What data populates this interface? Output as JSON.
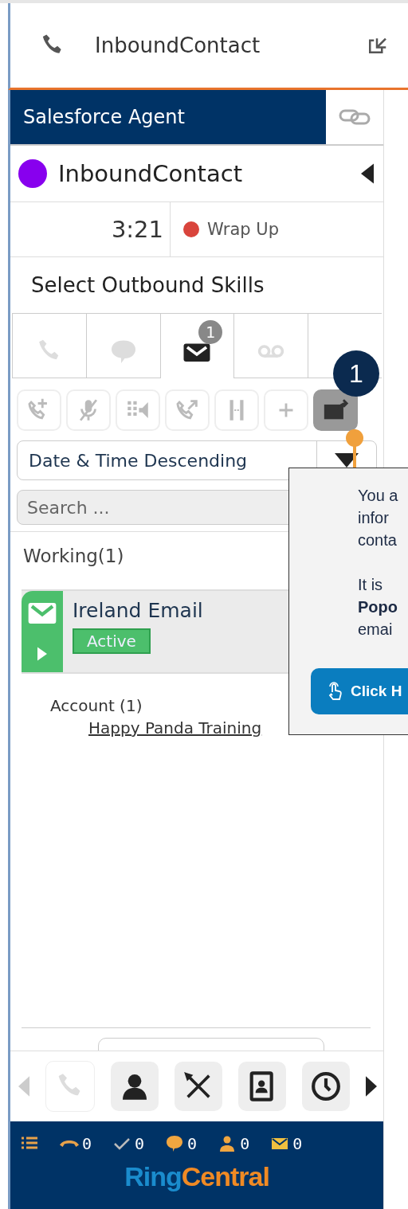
{
  "header": {
    "title": "InboundContact"
  },
  "agent_tab": {
    "label": "Salesforce Agent"
  },
  "contact": {
    "name": "InboundContact",
    "color": "#8800ee"
  },
  "timer": {
    "elapsed": "3:21",
    "status": "Wrap Up",
    "color": "#d9443c"
  },
  "skills": {
    "label": "Select Outbound Skills"
  },
  "channel_tabs": [
    {
      "kind": "phone",
      "selected": false
    },
    {
      "kind": "chat",
      "selected": false
    },
    {
      "kind": "email",
      "selected": true,
      "badge": "1"
    },
    {
      "kind": "voicemail",
      "selected": false
    },
    {
      "kind": "blank",
      "selected": false
    }
  ],
  "call_tools": [
    {
      "kind": "add-call",
      "disabled": true
    },
    {
      "kind": "mute",
      "disabled": true
    },
    {
      "kind": "keypad",
      "disabled": true
    },
    {
      "kind": "transfer",
      "disabled": true
    },
    {
      "kind": "hold",
      "disabled": true
    },
    {
      "kind": "plus",
      "disabled": true
    },
    {
      "kind": "email-transfer",
      "disabled": false
    }
  ],
  "sort": {
    "value": "Date & Time Descending"
  },
  "search": {
    "placeholder": "Search ..."
  },
  "working": {
    "label": "Working(1)",
    "items": [
      {
        "title": "Ireland Email",
        "status": "Active"
      }
    ]
  },
  "related": {
    "label": "Account (1)",
    "link": "Happy Panda Training"
  },
  "nav_tools": [
    {
      "kind": "phone",
      "disabled": true
    },
    {
      "kind": "person",
      "disabled": false
    },
    {
      "kind": "tools",
      "disabled": false
    },
    {
      "kind": "contacts",
      "disabled": false
    },
    {
      "kind": "clock",
      "disabled": false
    }
  ],
  "footer": {
    "counters": [
      {
        "kind": "call",
        "value": "0"
      },
      {
        "kind": "check",
        "value": "0"
      },
      {
        "kind": "chat",
        "value": "0"
      },
      {
        "kind": "person",
        "value": "0"
      },
      {
        "kind": "email",
        "value": "0"
      }
    ],
    "logo": {
      "first": "Ring",
      "second": "Central"
    }
  },
  "callout": {
    "number": "1",
    "paragraphs": [
      {
        "lines": [
          {
            "text": "You a",
            "bold": false
          },
          {
            "text": "infor",
            "bold": false
          },
          {
            "text": "conta",
            "bold": false
          }
        ]
      },
      {
        "lines": [
          {
            "text": "It is",
            "bold": false
          },
          {
            "text": "Popo",
            "bold": true
          },
          {
            "text": "emai",
            "bold": false
          }
        ]
      }
    ],
    "button": "Click H"
  }
}
